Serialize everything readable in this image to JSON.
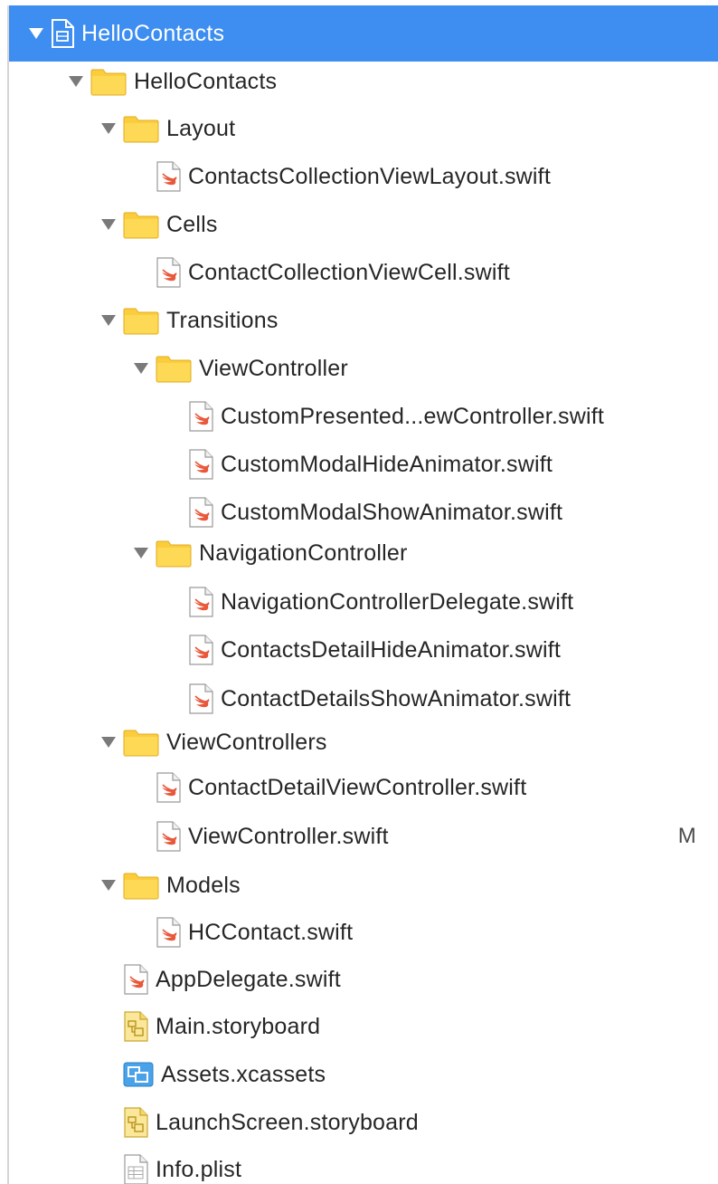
{
  "navigator": {
    "items": [
      {
        "label": "HelloContacts",
        "type": "project",
        "depth": 0,
        "expanded": true,
        "selected": true
      },
      {
        "label": "HelloContacts",
        "type": "folder",
        "depth": 1,
        "expanded": true
      },
      {
        "label": "Layout",
        "type": "folder",
        "depth": 2,
        "expanded": true
      },
      {
        "label": "ContactsCollectionViewLayout.swift",
        "type": "swift",
        "depth": 3
      },
      {
        "label": "Cells",
        "type": "folder",
        "depth": 2,
        "expanded": true
      },
      {
        "label": "ContactCollectionViewCell.swift",
        "type": "swift",
        "depth": 3
      },
      {
        "label": "Transitions",
        "type": "folder",
        "depth": 2,
        "expanded": true
      },
      {
        "label": "ViewController",
        "type": "folder",
        "depth": 3,
        "expanded": true
      },
      {
        "label": "CustomPresented...ewController.swift",
        "type": "swift",
        "depth": 4
      },
      {
        "label": "CustomModalHideAnimator.swift",
        "type": "swift",
        "depth": 4
      },
      {
        "label": "CustomModalShowAnimator.swift",
        "type": "swift",
        "depth": 4
      },
      {
        "label": "NavigationController",
        "type": "folder",
        "depth": 3,
        "expanded": true
      },
      {
        "label": "NavigationControllerDelegate.swift",
        "type": "swift",
        "depth": 4
      },
      {
        "label": "ContactsDetailHideAnimator.swift",
        "type": "swift",
        "depth": 4
      },
      {
        "label": "ContactDetailsShowAnimator.swift",
        "type": "swift",
        "depth": 4
      },
      {
        "label": "ViewControllers",
        "type": "folder",
        "depth": 2,
        "expanded": true
      },
      {
        "label": "ContactDetailViewController.swift",
        "type": "swift",
        "depth": 3
      },
      {
        "label": "ViewController.swift",
        "type": "swift",
        "depth": 3,
        "badge": "M"
      },
      {
        "label": "Models",
        "type": "folder",
        "depth": 2,
        "expanded": true
      },
      {
        "label": "HCContact.swift",
        "type": "swift",
        "depth": 3
      },
      {
        "label": "AppDelegate.swift",
        "type": "swift",
        "depth": 2
      },
      {
        "label": "Main.storyboard",
        "type": "storyboard",
        "depth": 2
      },
      {
        "label": "Assets.xcassets",
        "type": "assets",
        "depth": 2
      },
      {
        "label": "LaunchScreen.storyboard",
        "type": "storyboard",
        "depth": 2
      },
      {
        "label": "Info.plist",
        "type": "plist",
        "depth": 2
      }
    ]
  },
  "colors": {
    "selection": "#3d8ef0",
    "folder": "#fbcd3c",
    "swift": "#e8583b",
    "text": "#262626",
    "disclosure": "#7a7a7a"
  }
}
